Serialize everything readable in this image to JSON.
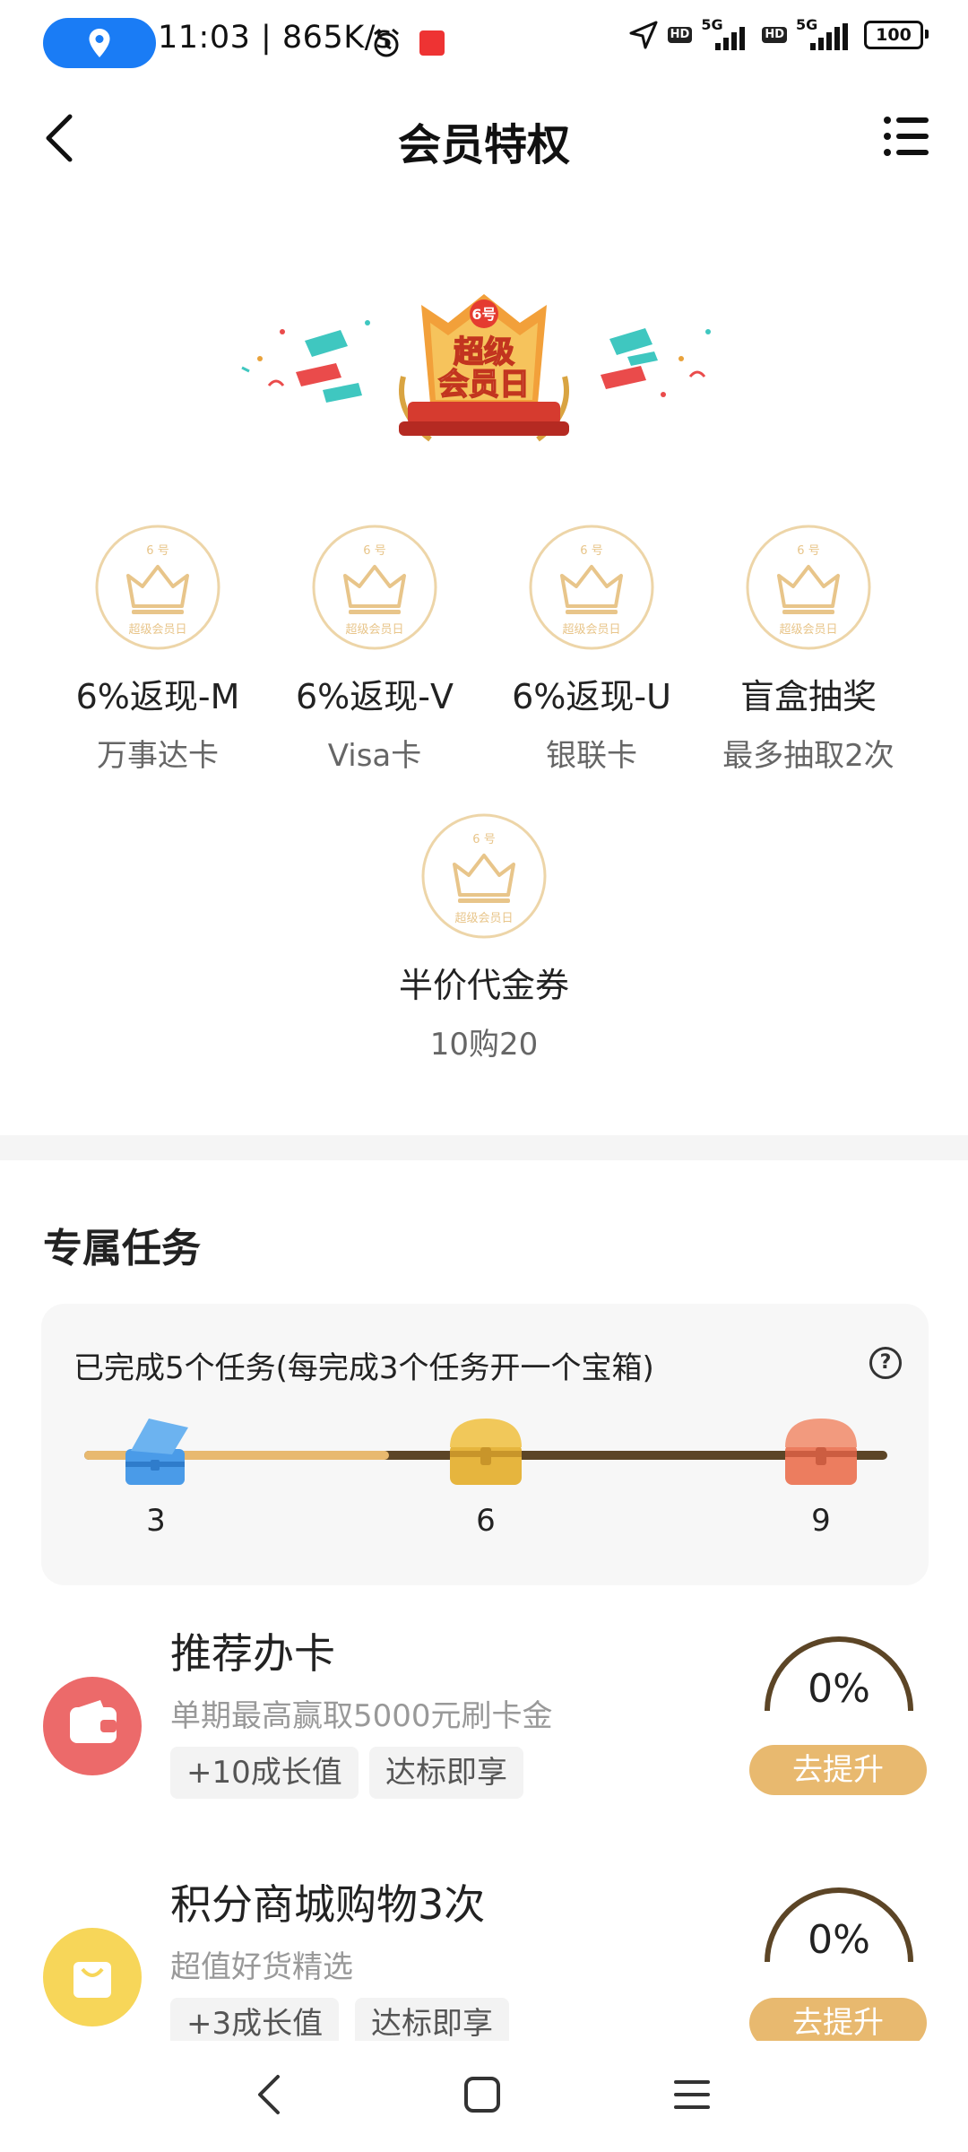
{
  "status_bar": {
    "time_speed": "11:03 | 865K/s",
    "signal_label_1": "5G",
    "signal_label_2": "5G",
    "hd_1": "HD",
    "hd_2": "HD",
    "battery": "100",
    "icons": [
      "location-icon",
      "alarm-icon",
      "app-notification-icon",
      "navigation-arrow-icon",
      "signal-icon",
      "battery-icon"
    ]
  },
  "nav": {
    "title": "会员特权",
    "back_icon": "chevron-left-icon",
    "menu_icon": "list-menu-icon"
  },
  "banner": {
    "badge": "6号",
    "line1": "超级",
    "line2": "会员日"
  },
  "medal": {
    "top_text": "6 号",
    "bottom_text": "超级会员日"
  },
  "privileges": [
    {
      "name": "6%返现-M",
      "desc": "万事达卡"
    },
    {
      "name": "6%返现-V",
      "desc": "Visa卡"
    },
    {
      "name": "6%返现-U",
      "desc": "银联卡"
    },
    {
      "name": "盲盒抽奖",
      "desc": "最多抽取2次"
    },
    {
      "name": "半价代金券",
      "desc": "10购20"
    }
  ],
  "tasks_section": {
    "title": "专属任务",
    "summary": "已完成5个任务(每完成3个任务开一个宝箱)",
    "help": "?",
    "progress": 0.38,
    "milestones": [
      {
        "label": "3",
        "color": "#4a9be8",
        "opened": true
      },
      {
        "label": "6",
        "color": "#e6b53e",
        "opened": false
      },
      {
        "label": "9",
        "color": "#ec7d5f",
        "opened": false
      }
    ]
  },
  "task_items": [
    {
      "title": "推荐办卡",
      "subtitle": "单期最高赢取5000元刷卡金",
      "tags": [
        "+10成长值",
        "达标即享"
      ],
      "percent": "0%",
      "button": "去提升",
      "icon": "wallet-icon",
      "icon_color": "#ec6a6a"
    },
    {
      "title": "积分商城购物3次",
      "subtitle": "超值好货精选",
      "tags": [
        "+3成长值",
        "达标即享"
      ],
      "percent": "0%",
      "button": "去提升",
      "icon": "shopping-bag-icon",
      "icon_color": "#f7d659"
    }
  ],
  "system_nav": {
    "icons": [
      "back-icon",
      "home-icon",
      "recents-icon"
    ]
  },
  "colors": {
    "accent_gold": "#e8b96f",
    "track_dark": "#5c4526",
    "status_pill": "#1a7cf5"
  }
}
